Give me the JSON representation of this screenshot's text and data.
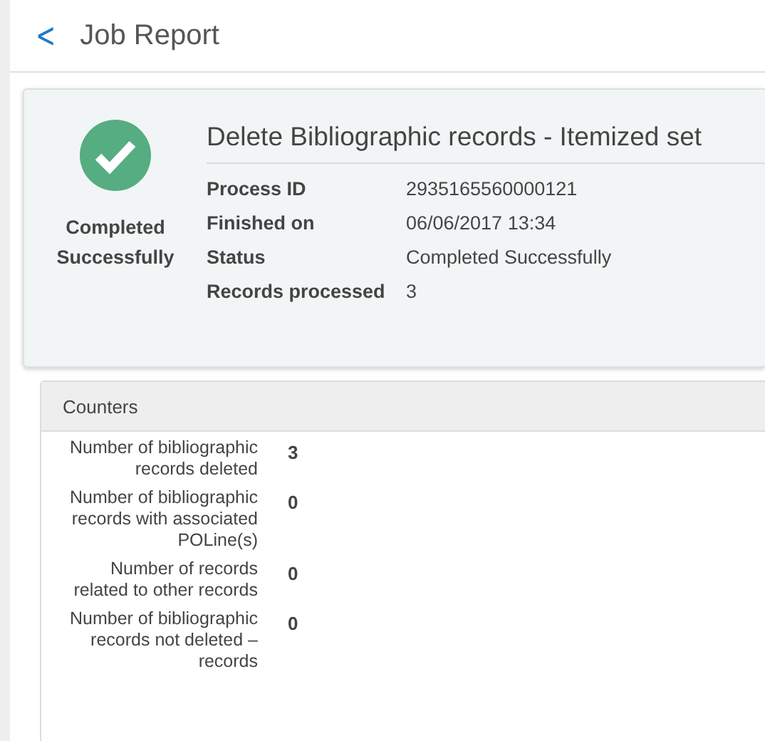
{
  "header": {
    "back": "<",
    "title": "Job Report"
  },
  "summary": {
    "status_label": "Completed Successfully",
    "job_title": "Delete Bibliographic records - Itemized set",
    "fields": [
      {
        "label": "Process ID",
        "value": "2935165560000121"
      },
      {
        "label": "Finished on",
        "value": "06/06/2017 13:34"
      },
      {
        "label": "Status",
        "value": "Completed Successfully"
      },
      {
        "label": "Records processed",
        "value": "3"
      }
    ]
  },
  "counters": {
    "title": "Counters",
    "rows": [
      {
        "label": "Number of bibliographic records deleted",
        "value": "3"
      },
      {
        "label": "Number of bibliographic records with associated POLine(s)",
        "value": "0"
      },
      {
        "label": "Number of records related to other records",
        "value": "0"
      },
      {
        "label": "Number of bibliographic records not deleted – records",
        "value": "0"
      }
    ]
  }
}
